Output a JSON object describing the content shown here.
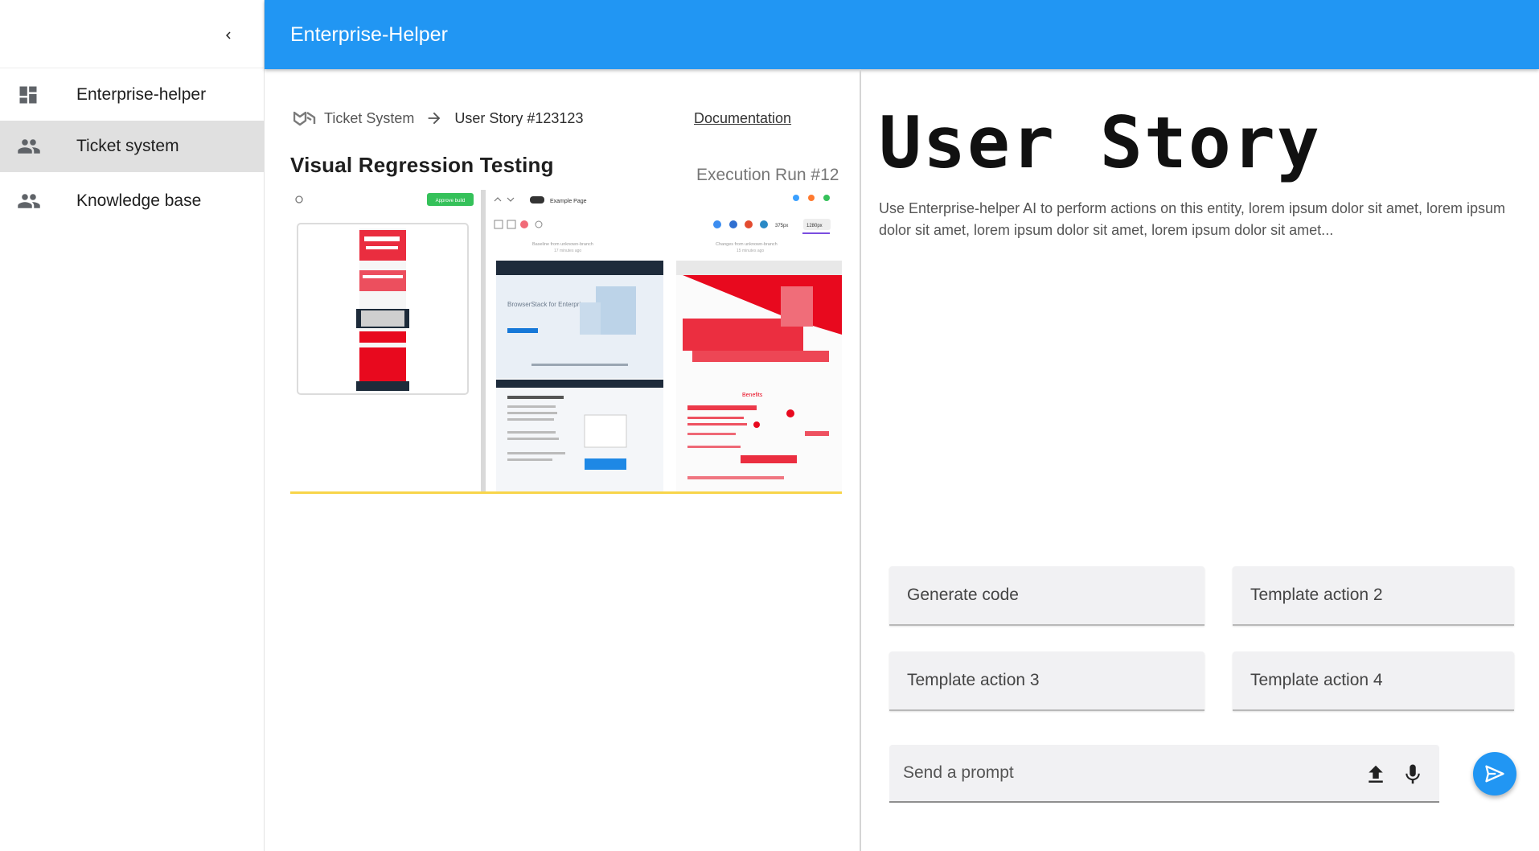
{
  "app": {
    "title": "Enterprise-Helper"
  },
  "sidebar": {
    "collapse_icon": "chevron-left-icon",
    "items": [
      {
        "label": "Enterprise-helper",
        "icon": "dashboard-icon",
        "active": false
      },
      {
        "label": "Ticket system",
        "icon": "people-icon",
        "active": true
      },
      {
        "label": "Knowledge base",
        "icon": "people-icon",
        "active": false
      }
    ]
  },
  "ticket": {
    "breadcrumb": {
      "system": "Ticket System",
      "story": "User Story #123123"
    },
    "documentation_link": "Documentation",
    "title": "Visual Regression Testing",
    "run_label": "Execution Run #12",
    "screenshot": {
      "approve_label": "Approve build",
      "page_label": "Example Page",
      "baseline_text": "Baseline from  unknown-branch",
      "baseline_time": "17 minutes ago",
      "changes_text": "Changes from  unknown-branch",
      "changes_time": "15 minutes ago",
      "width_small": "375px",
      "width_large": "1280px",
      "hero_text": "BrowserStack for Enterprise",
      "benefits_text": "Benefits"
    }
  },
  "story": {
    "title": "User Story",
    "description": "Use Enterprise-helper AI to perform actions on this entity, lorem ipsum dolor sit amet, lorem ipsum dolor sit amet, lorem ipsum dolor sit amet, lorem ipsum dolor sit amet..."
  },
  "actions": [
    {
      "label": "Generate code"
    },
    {
      "label": "Template action 2"
    },
    {
      "label": "Template action 3"
    },
    {
      "label": "Template action 4"
    }
  ],
  "prompt": {
    "placeholder": "Send a prompt"
  },
  "colors": {
    "primary": "#2196f3",
    "highlight": "#f8d54a",
    "diff_red": "#e8091e",
    "approve_green": "#35c15a"
  }
}
